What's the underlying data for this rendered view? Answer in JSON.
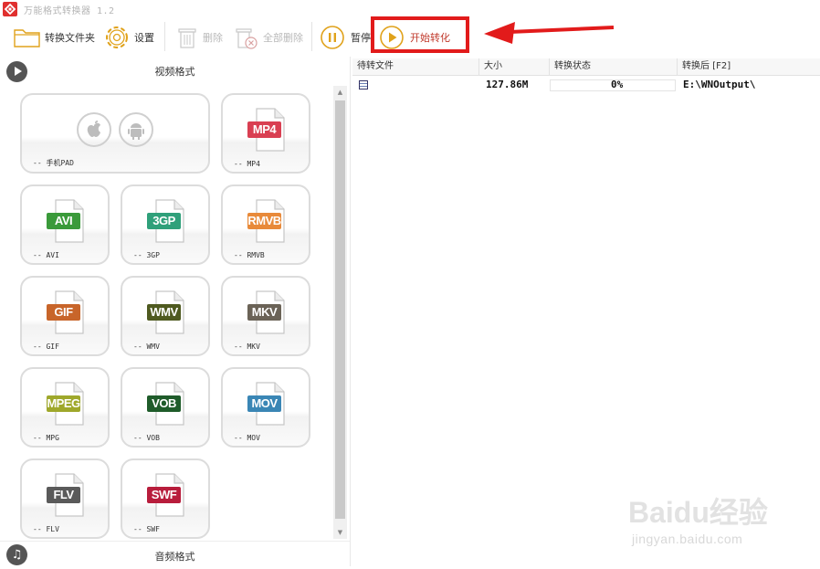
{
  "window": {
    "title": "万能格式转换器 1.2"
  },
  "toolbar": {
    "convert_folder": "转换文件夹",
    "settings": "设置",
    "delete": "删除",
    "delete_all": "全部删除",
    "pause": "暂停",
    "start_convert": "开始转化"
  },
  "icons": {
    "logo": "app-logo-icon",
    "folder": "folder-icon",
    "settings": "gear-icon",
    "delete": "trash-icon",
    "delete_all": "trash-x-icon",
    "pause": "pause-icon",
    "start": "play-icon",
    "video_section": "play-circle-icon",
    "audio_section": "music-note-icon"
  },
  "left": {
    "video_section_title": "视频格式",
    "audio_section_title": "音频格式",
    "formats": [
      {
        "caption": "-- 手机PAD",
        "badge": "",
        "color": ""
      },
      {
        "caption": "-- MP4",
        "badge": "MP4",
        "color": "#d93f52"
      },
      {
        "caption": "-- AVI",
        "badge": "AVI",
        "color": "#3a9a3a"
      },
      {
        "caption": "-- 3GP",
        "badge": "3GP",
        "color": "#2fa07a"
      },
      {
        "caption": "-- RMVB",
        "badge": "RMVB",
        "color": "#e88a3a"
      },
      {
        "caption": "-- GIF",
        "badge": "GIF",
        "color": "#c8652a"
      },
      {
        "caption": "-- WMV",
        "badge": "WMV",
        "color": "#4f5a20"
      },
      {
        "caption": "-- MKV",
        "badge": "MKV",
        "color": "#6b6357"
      },
      {
        "caption": "-- MPG",
        "badge": "MPEG",
        "color": "#9fa82b"
      },
      {
        "caption": "-- VOB",
        "badge": "VOB",
        "color": "#1f5c2a"
      },
      {
        "caption": "-- MOV",
        "badge": "MOV",
        "color": "#3a86b5"
      },
      {
        "caption": "-- FLV",
        "badge": "FLV",
        "color": "#5a5a5a"
      },
      {
        "caption": "-- SWF",
        "badge": "SWF",
        "color": "#b81d3c"
      }
    ]
  },
  "list": {
    "headers": [
      "待转文件",
      "大小",
      "转换状态",
      "转换后 [F2]"
    ],
    "rows": [
      {
        "file": "",
        "size": "127.86M",
        "status": "0%",
        "progress": 0,
        "output": "E:\\WNOutput\\"
      }
    ]
  },
  "watermark": {
    "brand": "Baidu经验",
    "url": "jingyan.baidu.com"
  }
}
